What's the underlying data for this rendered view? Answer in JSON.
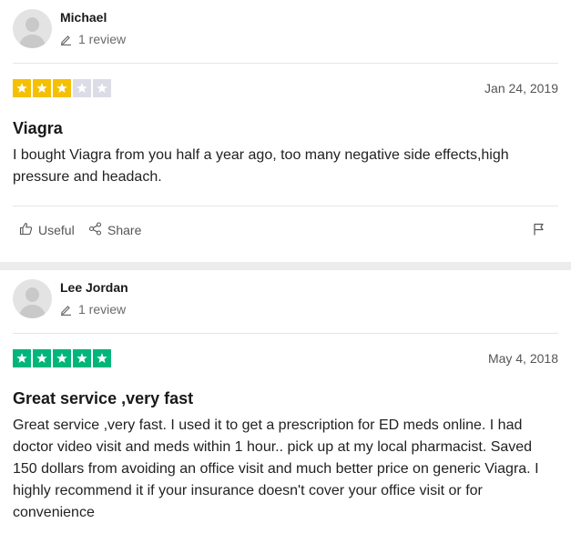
{
  "reviews": [
    {
      "reviewer": "Michael",
      "review_count": "1 review",
      "rating": 3,
      "star_color": "#f5c002",
      "date": "Jan 24, 2019",
      "title": "Viagra",
      "text": "I bought Viagra from you half a year ago, too many negative side effects,high pressure and headach.",
      "useful_label": "Useful",
      "share_label": "Share"
    },
    {
      "reviewer": "Lee Jordan",
      "review_count": "1 review",
      "rating": 5,
      "star_color": "#00b67a",
      "date": "May 4, 2018",
      "title": "Great service ,very fast",
      "text": "Great service ,very fast. I used it to get a prescription for ED meds online. I had doctor video visit and meds within 1 hour.. pick up at my local pharmacist. Saved 150 dollars from avoiding an office visit and much better price on generic Viagra. I highly recommend it if your insurance doesn't cover your office visit or for convenience"
    }
  ],
  "colors": {
    "empty_star": "#dcdce6",
    "separator": "#ececec"
  },
  "icons": [
    "pencil-icon",
    "thumbs-up-icon",
    "share-icon",
    "flag-icon",
    "star-icon"
  ]
}
